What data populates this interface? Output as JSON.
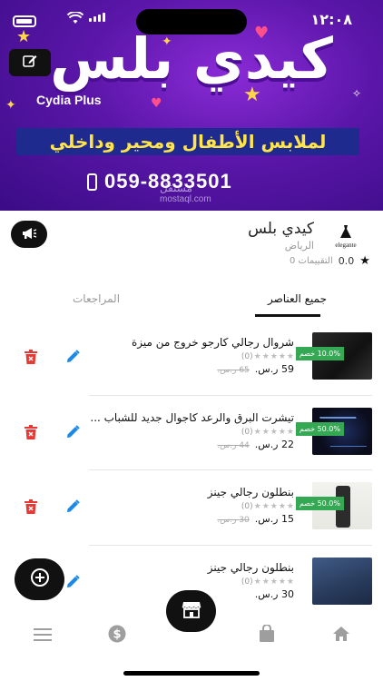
{
  "status_bar": {
    "time": "١٢:٠٨"
  },
  "banner": {
    "brand_title": "كيدي بلس",
    "brand_subtitle": "Cydia Plus",
    "tagline": "لملابس الأطفال ومحير وداخلي",
    "phone": "059-8833501",
    "watermark": "مستقل",
    "watermark_sub": "mostaql.com",
    "colors": {
      "background": "#5a16a8",
      "tagline_bg": "#1f2a8f",
      "tagline_text": "#ffe54a"
    }
  },
  "store": {
    "name": "كيدي بلس",
    "city": "الرياض",
    "logo_text": "elegante",
    "ratings_label": "0 التقييمات",
    "rating_value": "0.0"
  },
  "tabs": [
    {
      "label": "جميع العناصر",
      "active": true
    },
    {
      "label": "المراجعات",
      "active": false
    }
  ],
  "products": [
    {
      "name": "شروال رجالي كارجو خروج من ميزة",
      "discount": "10.0% خصم",
      "rating_count": "(0)",
      "price": "59 ر.س.",
      "old_price": "65 ر.س."
    },
    {
      "name": "تيشرت البرق والرعد كاجوال جديد للشباب ...",
      "discount": "50.0% خصم",
      "rating_count": "(0)",
      "price": "22 ر.س.",
      "old_price": "44 ر.س."
    },
    {
      "name": "بنطلون رجالي جينز",
      "discount": "50.0% خصم",
      "rating_count": "(0)",
      "price": "15 ر.س.",
      "old_price": "30 ر.س."
    },
    {
      "name": "بنطلون رجالي جينز",
      "discount": "",
      "rating_count": "(0)",
      "price": "30 ر.س.",
      "old_price": ""
    }
  ],
  "icons": {
    "edit": "pencil-icon",
    "delete": "trash-icon",
    "add": "plus-circle-icon",
    "store": "storefront-icon",
    "announce": "megaphone-icon",
    "nav": [
      "menu-icon",
      "dollar-icon",
      "bag-icon",
      "home-icon"
    ]
  },
  "colors": {
    "edit": "#1e88e5",
    "delete": "#e53935",
    "discount": "#35a853",
    "nav_icon": "#9e9e9e"
  }
}
